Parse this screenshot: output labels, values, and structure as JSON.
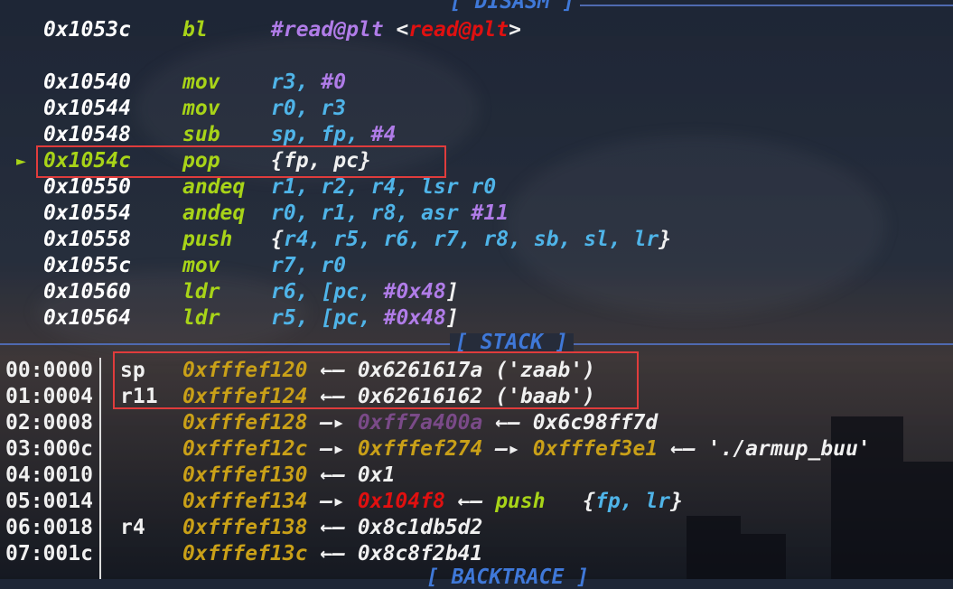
{
  "sections": {
    "disasm_label": "[ DISASM ]",
    "stack_label": "[ STACK ]",
    "backtrace_label": "[ BACKTRACE ]"
  },
  "disasm": [
    {
      "addr": "0x1053c",
      "mnem": "bl",
      "ops": [
        {
          "t": "#read@plt",
          "c": "sym"
        },
        {
          "t": " <",
          "c": "white"
        },
        {
          "t": "read@plt",
          "c": "symred"
        },
        {
          "t": ">",
          "c": "white"
        }
      ],
      "current": false
    },
    {
      "addr": "0x10540",
      "mnem": "mov",
      "ops": [
        {
          "t": "r3, ",
          "c": "oprnd"
        },
        {
          "t": "#0",
          "c": "imm"
        }
      ],
      "current": false
    },
    {
      "addr": "0x10544",
      "mnem": "mov",
      "ops": [
        {
          "t": "r0, r3",
          "c": "oprnd"
        }
      ],
      "current": false
    },
    {
      "addr": "0x10548",
      "mnem": "sub",
      "ops": [
        {
          "t": "sp, fp, ",
          "c": "oprnd"
        },
        {
          "t": "#4",
          "c": "imm"
        }
      ],
      "current": false
    },
    {
      "addr": "0x1054c",
      "mnem": "pop",
      "ops": [
        {
          "t": "{fp, pc}",
          "c": "white"
        }
      ],
      "current": true
    },
    {
      "addr": "0x10550",
      "mnem": "andeq",
      "ops": [
        {
          "t": "r1, r2, r4, lsr r0",
          "c": "oprnd"
        }
      ],
      "current": false
    },
    {
      "addr": "0x10554",
      "mnem": "andeq",
      "ops": [
        {
          "t": "r0, r1, r8, asr ",
          "c": "oprnd"
        },
        {
          "t": "#11",
          "c": "imm"
        }
      ],
      "current": false
    },
    {
      "addr": "0x10558",
      "mnem": "push",
      "ops": [
        {
          "t": "{",
          "c": "white"
        },
        {
          "t": "r4, r5, r6, r7, r8, sb, sl, lr",
          "c": "oprnd"
        },
        {
          "t": "}",
          "c": "white"
        }
      ],
      "current": false
    },
    {
      "addr": "0x1055c",
      "mnem": "mov",
      "ops": [
        {
          "t": "r7, r0",
          "c": "oprnd"
        }
      ],
      "current": false
    },
    {
      "addr": "0x10560",
      "mnem": "ldr",
      "ops": [
        {
          "t": "r6, [pc, ",
          "c": "oprnd"
        },
        {
          "t": "#0x48",
          "c": "imm"
        },
        {
          "t": "]",
          "c": "white"
        }
      ],
      "current": false
    },
    {
      "addr": "0x10564",
      "mnem": "ldr",
      "ops": [
        {
          "t": "r5, [pc, ",
          "c": "oprnd"
        },
        {
          "t": "#0x48",
          "c": "imm"
        },
        {
          "t": "]",
          "c": "white"
        }
      ],
      "current": false
    }
  ],
  "current_marker": "►",
  "stack": [
    {
      "off": "00:0000",
      "reg": "sp",
      "chain": [
        {
          "t": "0xfffef120",
          "c": "stk-addr"
        },
        {
          "t": " ←— ",
          "c": "white"
        },
        {
          "t": "0x6261617a ('zaab')",
          "c": "white"
        }
      ]
    },
    {
      "off": "01:0004",
      "reg": "r11",
      "chain": [
        {
          "t": "0xfffef124",
          "c": "stk-addr"
        },
        {
          "t": " ←— ",
          "c": "white"
        },
        {
          "t": "0x62616162 ('baab')",
          "c": "white"
        }
      ]
    },
    {
      "off": "02:0008",
      "reg": "",
      "chain": [
        {
          "t": "0xfffef128",
          "c": "stk-addr"
        },
        {
          "t": " —▸ ",
          "c": "white"
        },
        {
          "t": "0xff7a400a",
          "c": "stk-dim"
        },
        {
          "t": " ←— ",
          "c": "white"
        },
        {
          "t": "0x6c98ff7d",
          "c": "white"
        }
      ]
    },
    {
      "off": "03:000c",
      "reg": "",
      "chain": [
        {
          "t": "0xfffef12c",
          "c": "stk-addr"
        },
        {
          "t": " —▸ ",
          "c": "white"
        },
        {
          "t": "0xfffef274",
          "c": "stk-addr"
        },
        {
          "t": " —▸ ",
          "c": "white"
        },
        {
          "t": "0xfffef3e1",
          "c": "stk-addr"
        },
        {
          "t": " ←— ",
          "c": "white"
        },
        {
          "t": "'./armup_buu'",
          "c": "white"
        }
      ]
    },
    {
      "off": "04:0010",
      "reg": "",
      "chain": [
        {
          "t": "0xfffef130",
          "c": "stk-addr"
        },
        {
          "t": " ←— ",
          "c": "white"
        },
        {
          "t": "0x1",
          "c": "white"
        }
      ]
    },
    {
      "off": "05:0014",
      "reg": "",
      "chain": [
        {
          "t": "0xfffef134",
          "c": "stk-addr"
        },
        {
          "t": " —▸ ",
          "c": "white"
        },
        {
          "t": "0x104f8",
          "c": "stk-red"
        },
        {
          "t": " ←— ",
          "c": "white"
        },
        {
          "t": "push",
          "c": "stk-green"
        },
        {
          "t": "   {",
          "c": "white"
        },
        {
          "t": "fp, lr",
          "c": "oprnd"
        },
        {
          "t": "}",
          "c": "white"
        }
      ]
    },
    {
      "off": "06:0018",
      "reg": "r4",
      "chain": [
        {
          "t": "0xfffef138",
          "c": "stk-addr"
        },
        {
          "t": " ←— ",
          "c": "white"
        },
        {
          "t": "0x8c1db5d2",
          "c": "white"
        }
      ]
    },
    {
      "off": "07:001c",
      "reg": "",
      "chain": [
        {
          "t": "0xfffef13c",
          "c": "stk-addr"
        },
        {
          "t": " ←— ",
          "c": "white"
        },
        {
          "t": "0x8c8f2b41",
          "c": "white"
        }
      ]
    }
  ]
}
